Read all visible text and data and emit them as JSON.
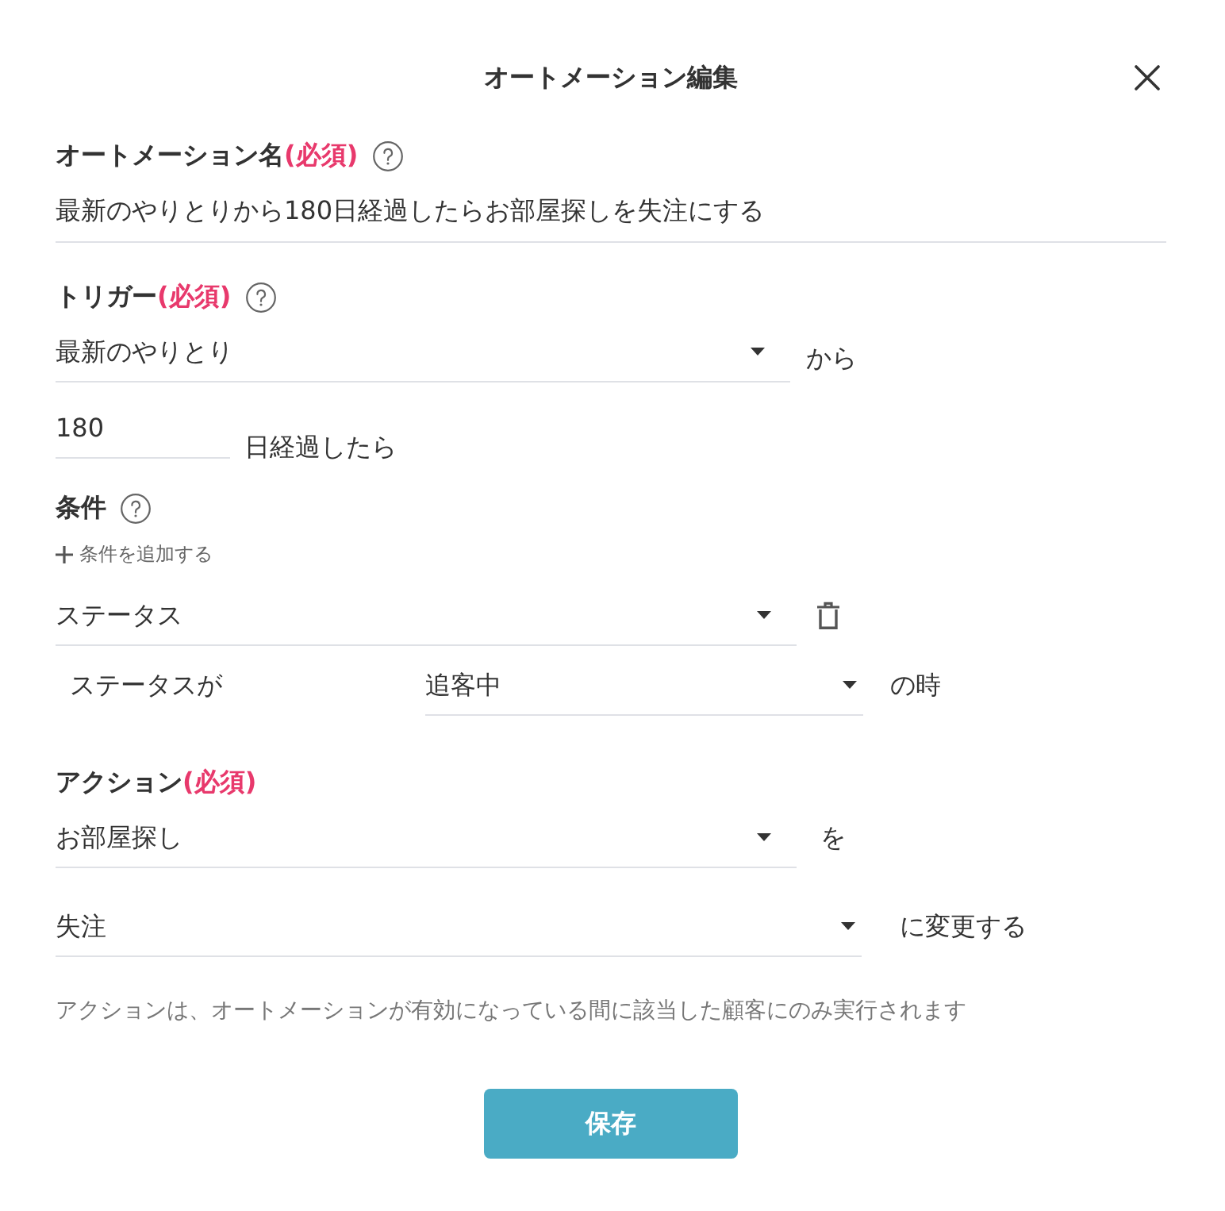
{
  "dialog": {
    "title": "オートメーション編集"
  },
  "automation_name": {
    "label": "オートメーション名",
    "required_mark": "(必須)",
    "help": true,
    "value": "最新のやりとりから180日経過したらお部屋探しを失注にする"
  },
  "trigger": {
    "label": "トリガー",
    "required_mark": "(必須)",
    "help": true,
    "select": {
      "value": "最新のやりとり",
      "suffix": "から"
    },
    "days": {
      "value": "180",
      "suffix": "日経過したら"
    }
  },
  "conditions": {
    "label": "条件",
    "help": true,
    "add_link": "条件を追加する",
    "items": [
      {
        "field": "ステータス",
        "operator_label": "ステータスが",
        "value": "追客中",
        "suffix": "の時"
      }
    ]
  },
  "action": {
    "label": "アクション",
    "required_mark": "(必須)",
    "target": {
      "value": "お部屋探し",
      "suffix": "を"
    },
    "new_value": {
      "value": "失注",
      "suffix": "に変更する"
    },
    "note": "アクションは、オートメーションが有効になっている間に該当した顧客にのみ実行されます"
  },
  "save_button": "保存"
}
